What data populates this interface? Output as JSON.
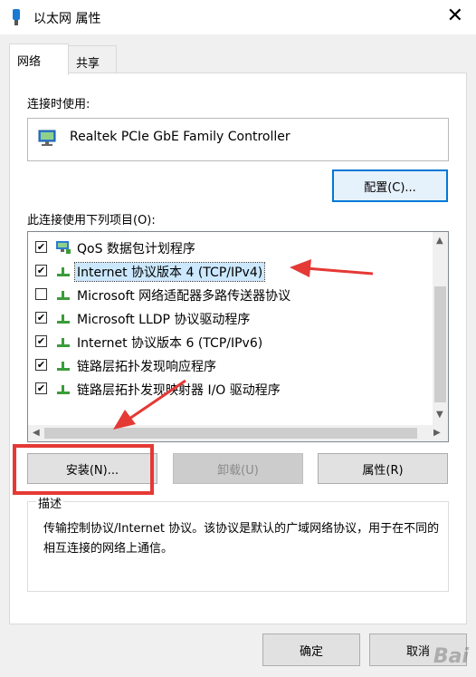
{
  "window": {
    "title": "以太网 属性"
  },
  "tabs": [
    {
      "label": "网络"
    },
    {
      "label": "共享"
    }
  ],
  "connect_using_label": "连接时使用:",
  "adapter": {
    "name": "Realtek PCIe GbE Family Controller"
  },
  "configure_button": "配置(C)...",
  "items_label": "此连接使用下列项目(O):",
  "items": [
    {
      "label": "QoS 数据包计划程序",
      "checked": true,
      "icon": "qos-icon"
    },
    {
      "label": "Internet 协议版本 4 (TCP/IPv4)",
      "checked": true,
      "icon": "protocol-icon",
      "selected": true
    },
    {
      "label": "Microsoft 网络适配器多路传送器协议",
      "checked": false,
      "icon": "protocol-icon"
    },
    {
      "label": "Microsoft LLDP 协议驱动程序",
      "checked": true,
      "icon": "protocol-icon"
    },
    {
      "label": "Internet 协议版本 6 (TCP/IPv6)",
      "checked": true,
      "icon": "protocol-icon"
    },
    {
      "label": "链路层拓扑发现响应程序",
      "checked": true,
      "icon": "protocol-icon"
    },
    {
      "label": "链路层拓扑发现映射器 I/O 驱动程序",
      "checked": true,
      "icon": "protocol-icon"
    }
  ],
  "buttons": {
    "install": "安装(N)...",
    "uninstall": "卸载(U)",
    "properties": "属性(R)"
  },
  "description": {
    "legend": "描述",
    "text": "传输控制协议/Internet 协议。该协议是默认的广域网络协议，用于在不同的相互连接的网络上通信。"
  },
  "footer": {
    "ok": "确定",
    "cancel": "取消"
  },
  "watermark": "Bai",
  "colors": {
    "accent": "#0078d7",
    "annotation": "#e53935",
    "selection": "#cce8ff"
  }
}
